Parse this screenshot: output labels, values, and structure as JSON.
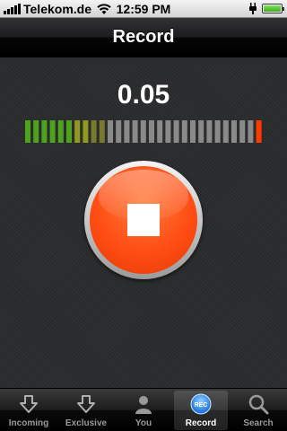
{
  "status_bar": {
    "carrier": "Telekom.de",
    "time": "12:59 PM"
  },
  "nav": {
    "title": "Record"
  },
  "recorder": {
    "level_display": "0.05",
    "meter": {
      "total_segments": 29,
      "lit_segments": 10,
      "peak_segment": 29,
      "colors": {
        "green": "#4da31d",
        "yellow_green": "#8f9a1f",
        "olive": "#7a7a2c",
        "off": "#8a8a8a",
        "peak": "#ff3b00"
      }
    },
    "stop_button_icon": "stop-square-icon",
    "button_color": "#ff4d14"
  },
  "tabs": [
    {
      "label": "Incoming",
      "icon": "arrow-down-icon",
      "active": false
    },
    {
      "label": "Exclusive",
      "icon": "arrow-down-icon",
      "active": false
    },
    {
      "label": "You",
      "icon": "person-icon",
      "active": false
    },
    {
      "label": "Record",
      "icon": "rec-icon",
      "active": true
    },
    {
      "label": "Search",
      "icon": "search-icon",
      "active": false
    }
  ]
}
